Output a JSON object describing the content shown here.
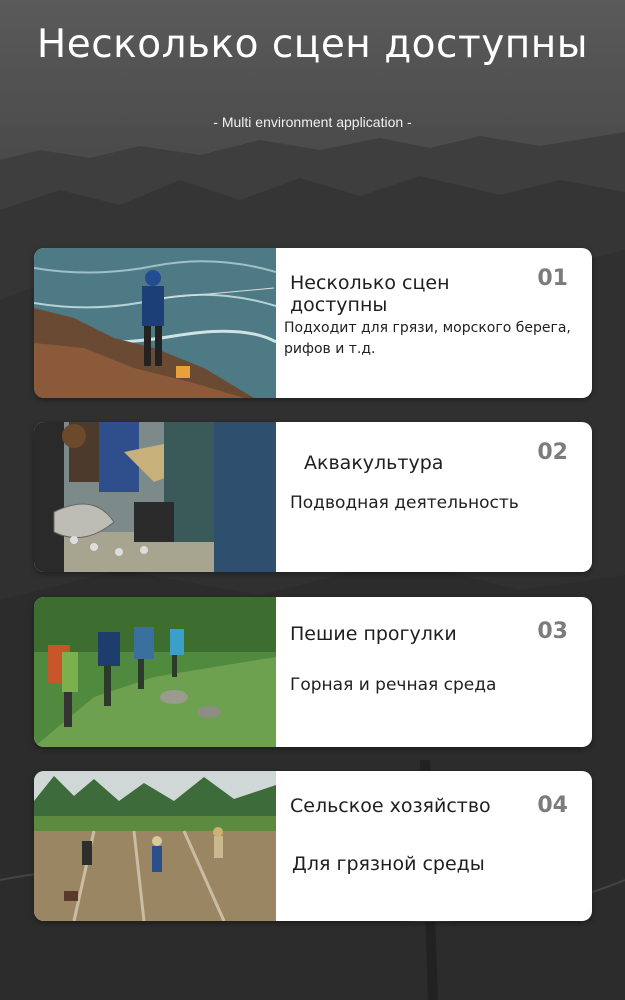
{
  "header": {
    "title": "Несколько сцен доступны",
    "subtitle": "- Multi environment application -"
  },
  "cards": [
    {
      "number": "01",
      "title": "Несколько сцен доступны",
      "description": "Подходит для грязи, морского берега, рифов и т.д.",
      "image": "angler-on-rocky-seashore"
    },
    {
      "number": "02",
      "title": "Аквакультура",
      "description": "Подводная деятельность",
      "image": "fish-farm-harvest"
    },
    {
      "number": "03",
      "title": "Пешие прогулки",
      "description": "Горная и речная среда",
      "image": "hikers-on-mountain-trail"
    },
    {
      "number": "04",
      "title": "Сельское хозяйство",
      "description": "Для грязной среды",
      "image": "farmers-in-rice-paddy"
    }
  ],
  "colors": {
    "background": "#3a3a3a",
    "card": "#ffffff",
    "text": "#1f1f1f",
    "number": "#7c7c7c",
    "title": "#ffffff"
  }
}
